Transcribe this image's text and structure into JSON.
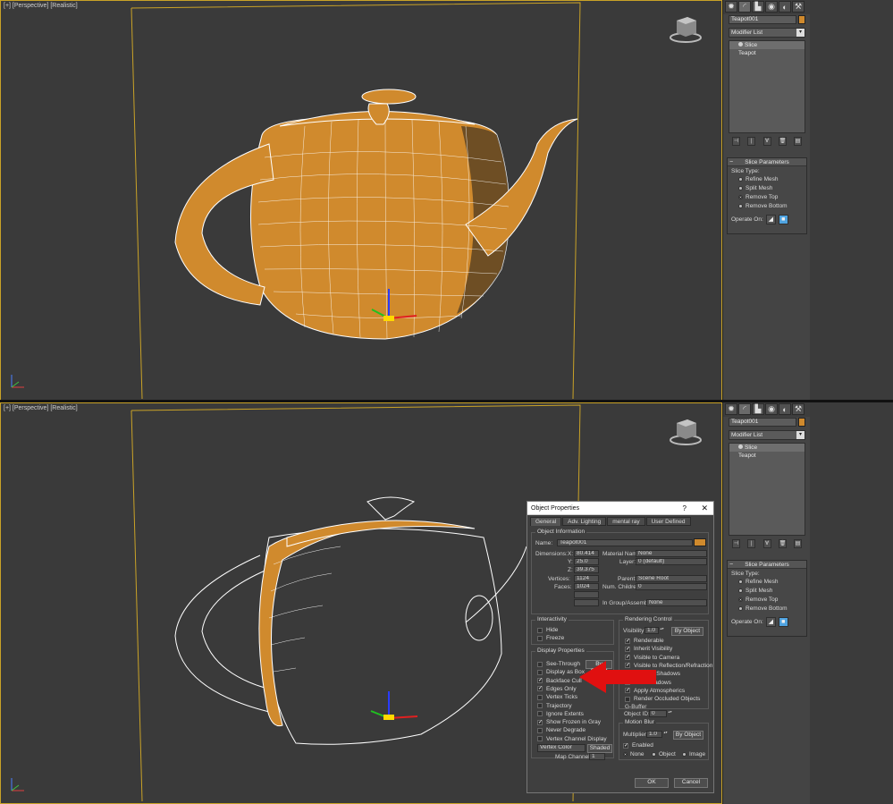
{
  "viewport": {
    "label": "[+] [Perspective] [Realistic]"
  },
  "command_panel": {
    "object_name": "Teapot001",
    "modifier_list": "Modifier List",
    "stack": [
      "Slice",
      "Teapot"
    ],
    "rollout_title": "Slice Parameters",
    "slice_type_label": "Slice Type:",
    "slice_types": [
      "Refine Mesh",
      "Split Mesh",
      "Remove Top",
      "Remove Bottom"
    ],
    "selected_slice_type": "Remove Top",
    "operate_on_label": "Operate On:"
  },
  "dialog": {
    "title": "Object Properties",
    "help": "?",
    "close": "✕",
    "tabs": [
      "General",
      "Adv. Lighting",
      "mental ray",
      "User Defined"
    ],
    "object_information": {
      "group_label": "Object Information",
      "name_label": "Name:",
      "name": "Teapot001",
      "dimensions_label": "Dimensions:",
      "x_label": "X:",
      "x": "80.414",
      "y_label": "Y:",
      "y": "25.0",
      "z_label": "Z:",
      "z": "39.375",
      "vertices_label": "Vertices:",
      "vertices": "1124",
      "faces_label": "Faces:",
      "faces": "1024",
      "material_name_label": "Material Name:",
      "material_name": "None",
      "layer_label": "Layer:",
      "layer": "0 (default)",
      "parent_label": "Parent:",
      "parent": "Scene Root",
      "num_children_label": "Num. Children:",
      "num_children": "0",
      "in_group_label": "In Group/Assembly:",
      "in_group": "None"
    },
    "interactivity": {
      "group_label": "Interactivity",
      "hide": "Hide",
      "freeze": "Freeze"
    },
    "display_properties": {
      "group_label": "Display Properties",
      "by_object": "By Object",
      "items": [
        {
          "label": "See-Through",
          "checked": false
        },
        {
          "label": "Display as Box",
          "checked": false
        },
        {
          "label": "Backface Cull",
          "checked": true
        },
        {
          "label": "Edges Only",
          "checked": true
        },
        {
          "label": "Vertex Ticks",
          "checked": false
        },
        {
          "label": "Trajectory",
          "checked": false
        },
        {
          "label": "Ignore Extents",
          "checked": false
        },
        {
          "label": "Show Frozen in Gray",
          "checked": true
        },
        {
          "label": "Never Degrade",
          "checked": false
        },
        {
          "label": "Vertex Channel Display",
          "checked": false
        }
      ],
      "vertex_color": "Vertex Color",
      "shaded": "Shaded",
      "map_channel_label": "Map Channel:",
      "map_channel": "1"
    },
    "rendering_control": {
      "group_label": "Rendering Control",
      "visibility_label": "Visibility:",
      "visibility": "1.0",
      "by_object": "By Object",
      "items": [
        {
          "label": "Renderable",
          "checked": true
        },
        {
          "label": "Inherit Visibility",
          "checked": true
        },
        {
          "label": "Visible to Camera",
          "checked": true
        },
        {
          "label": "Visible to Reflection/Refraction",
          "checked": true
        },
        {
          "label": "Receive Shadows",
          "checked": true
        },
        {
          "label": "Cast Shadows",
          "checked": true
        },
        {
          "label": "Apply Atmospherics",
          "checked": true
        },
        {
          "label": "Render Occluded Objects",
          "checked": false
        }
      ],
      "gbuffer_label": "G-Buffer",
      "object_id_label": "Object ID:",
      "object_id": "0"
    },
    "motion_blur": {
      "group_label": "Motion Blur",
      "multiplier_label": "Multiplier:",
      "multiplier": "1.0",
      "by_object": "By Object",
      "enabled": "Enabled",
      "options": [
        "None",
        "Object",
        "Image"
      ],
      "selected": "None"
    },
    "ok": "OK",
    "cancel": "Cancel"
  },
  "colors": {
    "teapot": "#d08a2d",
    "viewport_border": "#c9a227",
    "arrow": "#e01010"
  }
}
